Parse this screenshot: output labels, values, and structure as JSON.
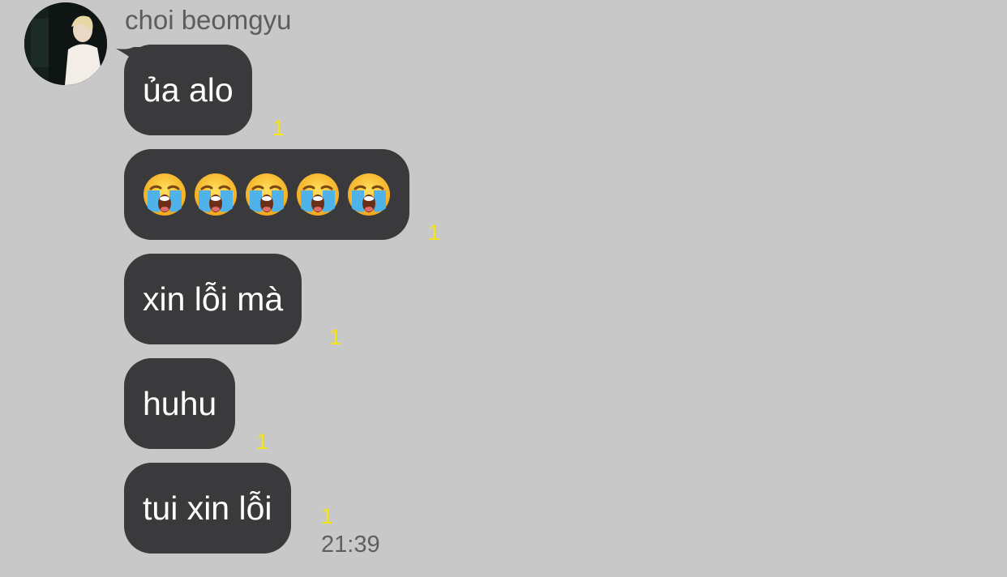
{
  "chat": {
    "sender_name": "choi beomgyu",
    "messages": [
      {
        "type": "text",
        "text": "ủa alo",
        "unread": "1"
      },
      {
        "type": "emoji",
        "emoji": [
          "loudly-crying-face",
          "loudly-crying-face",
          "loudly-crying-face",
          "loudly-crying-face",
          "loudly-crying-face"
        ],
        "unread": "1"
      },
      {
        "type": "text",
        "text": "xin lỗi mà",
        "unread": "1"
      },
      {
        "type": "text",
        "text": "huhu",
        "unread": "1"
      },
      {
        "type": "text",
        "text": "tui xin lỗi",
        "unread": "1"
      }
    ],
    "timestamp": "21:39"
  },
  "colors": {
    "background": "#c8c8c8",
    "bubble": "#3a3a3c",
    "bubble_text": "#ffffff",
    "unread_count": "#f3e412",
    "meta_text": "#5f5f5f"
  }
}
